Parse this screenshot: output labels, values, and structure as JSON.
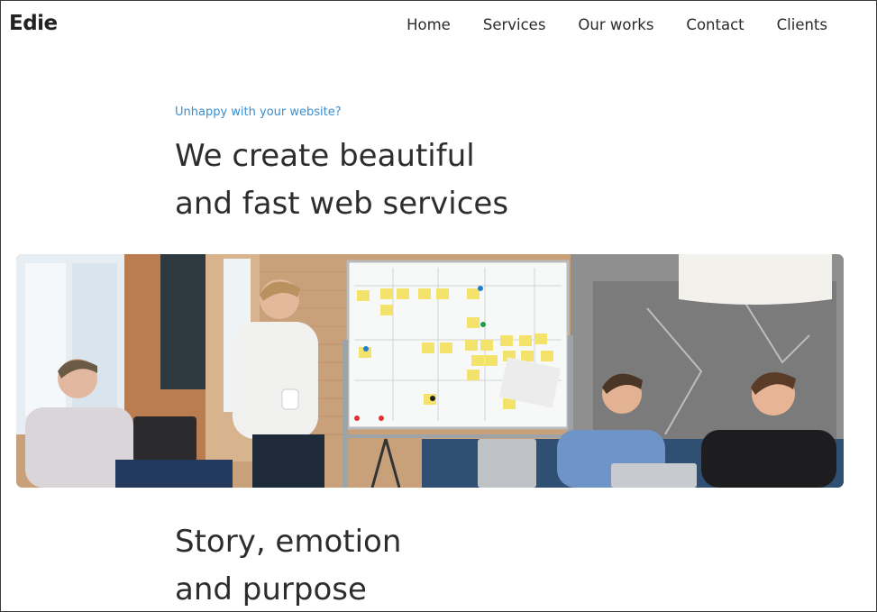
{
  "header": {
    "logo": "Edie",
    "nav": [
      "Home",
      "Services",
      "Our works",
      "Contact",
      "Clients"
    ]
  },
  "hero": {
    "kicker": "Unhappy with your website?",
    "headline_line1": "We create beautiful",
    "headline_line2": "and fast web services"
  },
  "section2": {
    "title_line1": "Story, emotion",
    "title_line2": "and purpose"
  },
  "colors": {
    "accent": "#3a8fd0",
    "text": "#2d2d2d"
  }
}
